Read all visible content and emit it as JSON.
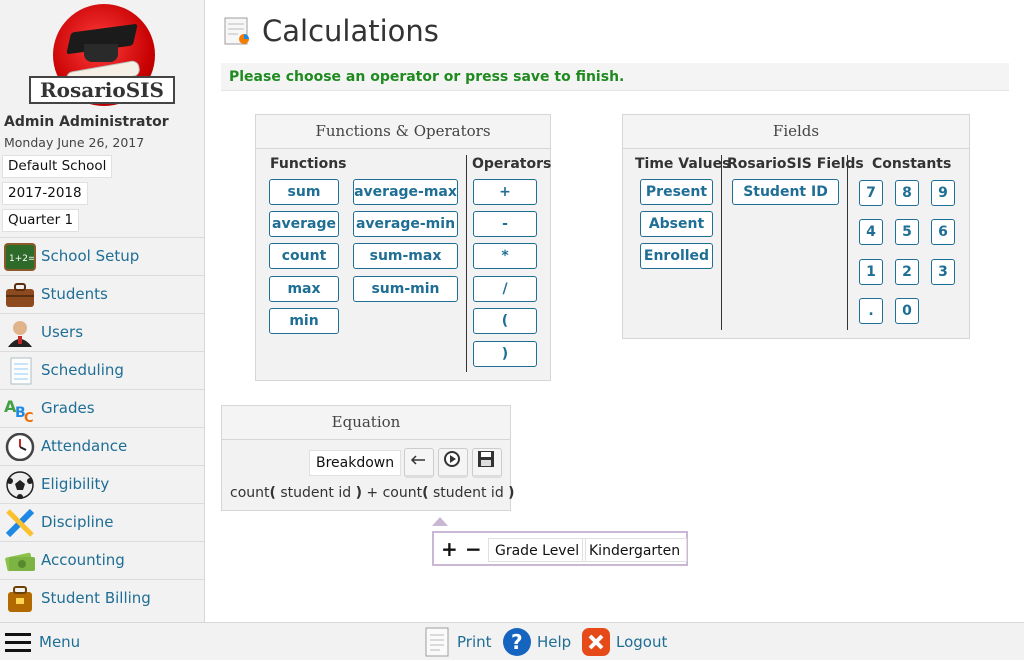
{
  "app": {
    "logo_text": "RosarioSIS"
  },
  "sidebar": {
    "user_name": "Admin Administrator",
    "date": "Monday June 26, 2017",
    "school": "Default School",
    "school_year": "2017-2018",
    "quarter": "Quarter 1",
    "items": [
      {
        "label": "School Setup",
        "icon": "school-setup-icon",
        "color": "#2e7d32"
      },
      {
        "label": "Students",
        "icon": "briefcase-icon",
        "color": "#8d4a1f"
      },
      {
        "label": "Users",
        "icon": "user-icon",
        "color": "#444444"
      },
      {
        "label": "Scheduling",
        "icon": "notepad-icon",
        "color": "#cfd8dc"
      },
      {
        "label": "Grades",
        "icon": "abc-icon",
        "color": "#ef6c00"
      },
      {
        "label": "Attendance",
        "icon": "clock-icon",
        "color": "#555555"
      },
      {
        "label": "Eligibility",
        "icon": "soccer-ball-icon",
        "color": "#222222"
      },
      {
        "label": "Discipline",
        "icon": "ruler-pencil-icon",
        "color": "#1e88e5"
      },
      {
        "label": "Accounting",
        "icon": "money-icon",
        "color": "#7cb342"
      },
      {
        "label": "Student Billing",
        "icon": "billing-bag-icon",
        "color": "#b26a00"
      }
    ]
  },
  "bottombar": {
    "menu": "Menu",
    "print": "Print",
    "help": "Help",
    "logout": "Logout"
  },
  "page": {
    "title": "Calculations",
    "instruction": "Please choose an operator or press save to finish."
  },
  "functions_panel": {
    "title": "Functions & Operators",
    "functions_header": "Functions",
    "operators_header": "Operators",
    "functions_col1": [
      "sum",
      "average",
      "count",
      "max",
      "min"
    ],
    "functions_col2": [
      "average-max",
      "average-min",
      "sum-max",
      "sum-min"
    ],
    "operators": [
      "+",
      "-",
      "*",
      "/",
      "(",
      ")"
    ]
  },
  "fields_panel": {
    "title": "Fields",
    "time_values_header": "Time Values",
    "rosario_fields_header": "RosarioSIS Fields",
    "constants_header": "Constants",
    "time_values": [
      "Present",
      "Absent",
      "Enrolled"
    ],
    "rosario_fields": [
      "Student ID"
    ],
    "constants": [
      "7",
      "8",
      "9",
      "4",
      "5",
      "6",
      "1",
      "2",
      "3",
      ".",
      "0"
    ]
  },
  "equation_panel": {
    "title": "Equation",
    "breakdown": "Breakdown",
    "equation_parts": [
      "count",
      "(",
      " student id ",
      ")",
      " + count",
      "(",
      " student id ",
      ")"
    ]
  },
  "breakdown_popup": {
    "plus": "+",
    "minus": "−",
    "field": "Grade Level",
    "value": "Kindergarten"
  }
}
